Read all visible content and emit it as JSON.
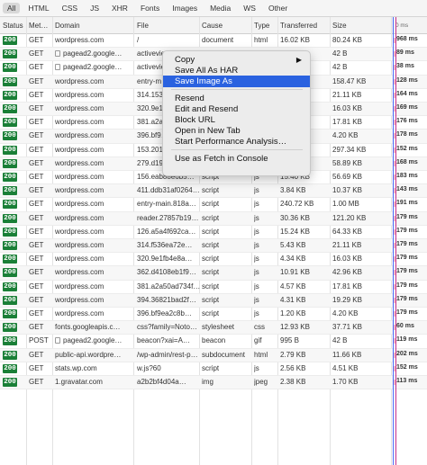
{
  "filters": [
    "All",
    "HTML",
    "CSS",
    "JS",
    "XHR",
    "Fonts",
    "Images",
    "Media",
    "WS",
    "Other"
  ],
  "active_filter": "All",
  "columns": [
    "Status",
    "Met…",
    "Domain",
    "File",
    "Cause",
    "Type",
    "Transferred",
    "Size",
    "0 ms"
  ],
  "rows": [
    {
      "status": "200",
      "method": "GET",
      "domain": "wordpress.com",
      "lock": false,
      "file": "/",
      "cause": "document",
      "type": "html",
      "transferred": "16.02 KB",
      "size": "80.24 KB",
      "time": "968 ms"
    },
    {
      "status": "200",
      "method": "GET",
      "domain": "pagead2.google…",
      "lock": true,
      "file": "activeview",
      "cause": "",
      "type": "",
      "transferred": "",
      "size": "42 B",
      "time": "89 ms"
    },
    {
      "status": "200",
      "method": "GET",
      "domain": "pagead2.google…",
      "lock": true,
      "file": "activeview",
      "cause": "",
      "type": "",
      "transferred": "",
      "size": "42 B",
      "time": "38 ms"
    },
    {
      "status": "200",
      "method": "GET",
      "domain": "wordpress.com",
      "lock": false,
      "file": "entry-m…",
      "cause": "",
      "type": "",
      "transferred": "",
      "size": "158.47 KB",
      "time": "128 ms"
    },
    {
      "status": "200",
      "method": "GET",
      "domain": "wordpress.com",
      "lock": false,
      "file": "314.1536…",
      "cause": "",
      "type": "",
      "transferred": "",
      "size": "21.11 KB",
      "time": "164 ms"
    },
    {
      "status": "200",
      "method": "GET",
      "domain": "wordpress.com",
      "lock": false,
      "file": "320.9e1f…",
      "cause": "",
      "type": "",
      "transferred": "",
      "size": "16.03 KB",
      "time": "169 ms"
    },
    {
      "status": "200",
      "method": "GET",
      "domain": "wordpress.com",
      "lock": false,
      "file": "381.a2a…",
      "cause": "",
      "type": "",
      "transferred": "",
      "size": "17.81 KB",
      "time": "176 ms"
    },
    {
      "status": "200",
      "method": "GET",
      "domain": "wordpress.com",
      "lock": false,
      "file": "396.bf9…",
      "cause": "",
      "type": "",
      "transferred": "",
      "size": "4.20 KB",
      "time": "178 ms"
    },
    {
      "status": "200",
      "method": "GET",
      "domain": "wordpress.com",
      "lock": false,
      "file": "153.20190a4cc9f…",
      "cause": "script",
      "type": "js",
      "transferred": "79.58 KB",
      "size": "297.34 KB",
      "time": "152 ms"
    },
    {
      "status": "200",
      "method": "GET",
      "domain": "wordpress.com",
      "lock": false,
      "file": "279.d197e3e2a…",
      "cause": "script",
      "type": "js",
      "transferred": "16.88 KB",
      "size": "58.89 KB",
      "time": "168 ms"
    },
    {
      "status": "200",
      "method": "GET",
      "domain": "wordpress.com",
      "lock": false,
      "file": "156.eab88e6b5…",
      "cause": "script",
      "type": "js",
      "transferred": "15.40 KB",
      "size": "56.69 KB",
      "time": "183 ms"
    },
    {
      "status": "200",
      "method": "GET",
      "domain": "wordpress.com",
      "lock": false,
      "file": "411.ddb31af0264…",
      "cause": "script",
      "type": "js",
      "transferred": "3.84 KB",
      "size": "10.37 KB",
      "time": "143 ms"
    },
    {
      "status": "200",
      "method": "GET",
      "domain": "wordpress.com",
      "lock": false,
      "file": "entry-main.818a…",
      "cause": "script",
      "type": "js",
      "transferred": "240.72 KB",
      "size": "1.00 MB",
      "time": "191 ms"
    },
    {
      "status": "200",
      "method": "GET",
      "domain": "wordpress.com",
      "lock": false,
      "file": "reader.27857b19…",
      "cause": "script",
      "type": "js",
      "transferred": "30.36 KB",
      "size": "121.20 KB",
      "time": "179 ms"
    },
    {
      "status": "200",
      "method": "GET",
      "domain": "wordpress.com",
      "lock": false,
      "file": "126.a5a4f692ca…",
      "cause": "script",
      "type": "js",
      "transferred": "15.24 KB",
      "size": "64.33 KB",
      "time": "179 ms"
    },
    {
      "status": "200",
      "method": "GET",
      "domain": "wordpress.com",
      "lock": false,
      "file": "314.f536ea72e…",
      "cause": "script",
      "type": "js",
      "transferred": "5.43 KB",
      "size": "21.11 KB",
      "time": "179 ms"
    },
    {
      "status": "200",
      "method": "GET",
      "domain": "wordpress.com",
      "lock": false,
      "file": "320.9e1fb4e8a…",
      "cause": "script",
      "type": "js",
      "transferred": "4.34 KB",
      "size": "16.03 KB",
      "time": "179 ms"
    },
    {
      "status": "200",
      "method": "GET",
      "domain": "wordpress.com",
      "lock": false,
      "file": "362.d4108eb1f9…",
      "cause": "script",
      "type": "js",
      "transferred": "10.91 KB",
      "size": "42.96 KB",
      "time": "179 ms"
    },
    {
      "status": "200",
      "method": "GET",
      "domain": "wordpress.com",
      "lock": false,
      "file": "381.a2a50ad734f…",
      "cause": "script",
      "type": "js",
      "transferred": "4.57 KB",
      "size": "17.81 KB",
      "time": "179 ms"
    },
    {
      "status": "200",
      "method": "GET",
      "domain": "wordpress.com",
      "lock": false,
      "file": "394.36821bad2f…",
      "cause": "script",
      "type": "js",
      "transferred": "4.31 KB",
      "size": "19.29 KB",
      "time": "179 ms"
    },
    {
      "status": "200",
      "method": "GET",
      "domain": "wordpress.com",
      "lock": false,
      "file": "396.bf9ea2c8b…",
      "cause": "script",
      "type": "js",
      "transferred": "1.20 KB",
      "size": "4.20 KB",
      "time": "179 ms"
    },
    {
      "status": "200",
      "method": "GET",
      "domain": "fonts.googleapis.c…",
      "lock": false,
      "file": "css?family=Noto…",
      "cause": "stylesheet",
      "type": "css",
      "transferred": "12.93 KB",
      "size": "37.71 KB",
      "time": "60 ms"
    },
    {
      "status": "200",
      "method": "POST",
      "domain": "pagead2.google…",
      "lock": true,
      "file": "beacon?xai=A…",
      "cause": "beacon",
      "type": "gif",
      "transferred": "995 B",
      "size": "42 B",
      "time": "119 ms"
    },
    {
      "status": "200",
      "method": "GET",
      "domain": "public-api.wordpre…",
      "lock": false,
      "file": "/wp-admin/rest-p…",
      "cause": "subdocument",
      "type": "html",
      "transferred": "2.79 KB",
      "size": "11.66 KB",
      "time": "202 ms"
    },
    {
      "status": "200",
      "method": "GET",
      "domain": "stats.wp.com",
      "lock": false,
      "file": "w.js?60",
      "cause": "script",
      "type": "js",
      "transferred": "2.56 KB",
      "size": "4.51 KB",
      "time": "152 ms"
    },
    {
      "status": "200",
      "method": "GET",
      "domain": "1.gravatar.com",
      "lock": false,
      "file": "a2b2bf4d04a…",
      "cause": "img",
      "type": "jpeg",
      "transferred": "2.38 KB",
      "size": "1.70 KB",
      "time": "113 ms"
    }
  ],
  "context_menu": {
    "items": [
      {
        "label": "Copy",
        "submenu": true
      },
      {
        "label": "Save All As HAR"
      },
      {
        "label": "Save Image As",
        "selected": true
      },
      {
        "sep": true
      },
      {
        "label": "Resend"
      },
      {
        "label": "Edit and Resend"
      },
      {
        "label": "Block URL"
      },
      {
        "label": "Open in New Tab"
      },
      {
        "label": "Start Performance Analysis…"
      },
      {
        "sep": true
      },
      {
        "label": "Use as Fetch in Console"
      }
    ]
  },
  "colors": {
    "status_ok": "#1a7f37",
    "menu_highlight": "#2a62e0",
    "waterfall_bar": "#f2b6c9",
    "dom_line": "#4a6cf7",
    "load_line": "#c7318c"
  }
}
